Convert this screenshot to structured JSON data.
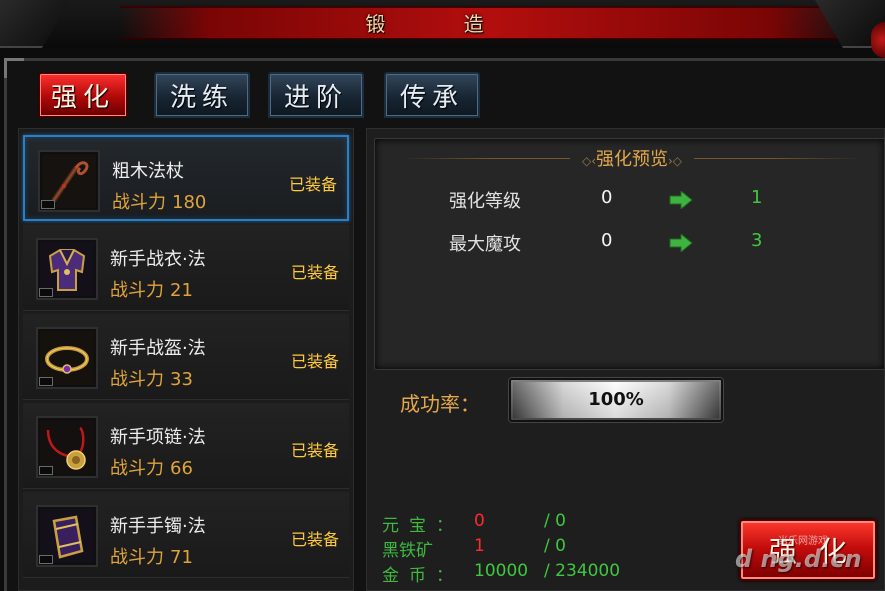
{
  "window": {
    "title": "锻 造"
  },
  "tabs": [
    {
      "label": "强化",
      "active": true
    },
    {
      "label": "洗练",
      "active": false
    },
    {
      "label": "进阶",
      "active": false
    },
    {
      "label": "传承",
      "active": false
    }
  ],
  "items": [
    {
      "name": "粗木法杖",
      "power_label": "战斗力",
      "power": "180",
      "status": "已装备",
      "icon": "staff-icon",
      "selected": true
    },
    {
      "name": "新手战衣·法",
      "power_label": "战斗力",
      "power": "21",
      "status": "已装备",
      "icon": "robe-icon",
      "selected": false
    },
    {
      "name": "新手战盔·法",
      "power_label": "战斗力",
      "power": "33",
      "status": "已装备",
      "icon": "circlet-icon",
      "selected": false
    },
    {
      "name": "新手项链·法",
      "power_label": "战斗力",
      "power": "66",
      "status": "已装备",
      "icon": "necklace-icon",
      "selected": false
    },
    {
      "name": "新手手镯·法",
      "power_label": "战斗力",
      "power": "71",
      "status": "已装备",
      "icon": "bracer-icon",
      "selected": false
    }
  ],
  "preview": {
    "title": "强化预览",
    "stats": [
      {
        "label": "强化等级",
        "from": "0",
        "to": "1"
      },
      {
        "label": "最大魔攻",
        "from": "0",
        "to": "3"
      }
    ]
  },
  "success": {
    "label": "成功率：",
    "value": "100%",
    "fraction": 1.0
  },
  "resources": [
    {
      "label": "元宝：",
      "have": "0",
      "need": "/ 0",
      "have_color": "#ff2b2b"
    },
    {
      "label": "黑铁矿",
      "have": "1",
      "need": "/  0",
      "have_color": "#ff2b2b"
    },
    {
      "label": "金币：",
      "have": "10000",
      "need": "/ 234000",
      "have_color": "#3fc83f"
    }
  ],
  "forge_button": {
    "label": "强化"
  },
  "watermark": {
    "text": "d ng.d.cn",
    "subtext": "当乐网游戏"
  },
  "colors": {
    "accent_red": "#c40d0d",
    "gold": "#e2a84a",
    "green": "#3fc83f",
    "selected_border": "#2b7fc2"
  }
}
